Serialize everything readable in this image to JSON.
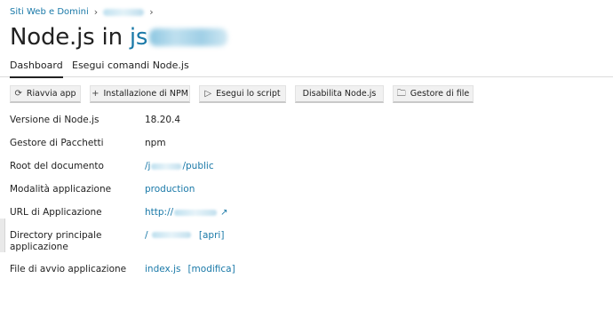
{
  "breadcrumb": {
    "root": "Siti Web e Domini",
    "domain": ""
  },
  "title": {
    "prefix": "Node.js in",
    "domain": "js"
  },
  "tabs": [
    "Dashboard",
    "Esegui comandi Node.js"
  ],
  "toolbar": {
    "restart": "Riavvia app",
    "npm_install": "Installazione di NPM",
    "run_script": "Esegui lo script",
    "disable": "Disabilita Node.js",
    "file_manager": "Gestore di file"
  },
  "info": {
    "node_version_label": "Versione di Node.js",
    "node_version": "18.20.4",
    "package_manager_label": "Gestore di Pacchetti",
    "package_manager": "npm",
    "document_root_label": "Root del documento",
    "document_root_prefix": "/j",
    "document_root_suffix": "/public",
    "app_mode_label": "Modalità applicazione",
    "app_mode": "production",
    "app_url_label": "URL di Applicazione",
    "app_url_prefix": "http://",
    "app_root_label": "Directory principale applicazione",
    "app_root_prefix": "/",
    "app_root_action": "[apri]",
    "startup_file_label": "File di avvio applicazione",
    "startup_file": "index.js",
    "startup_file_action": "[modifica]"
  },
  "icons": {
    "restart": "refresh-icon",
    "npm_install": "plus-icon",
    "run_script": "play-icon",
    "file_manager": "folder-icon",
    "external": "external-link-icon"
  },
  "colors": {
    "link": "#1a79a8",
    "text": "#222222"
  }
}
